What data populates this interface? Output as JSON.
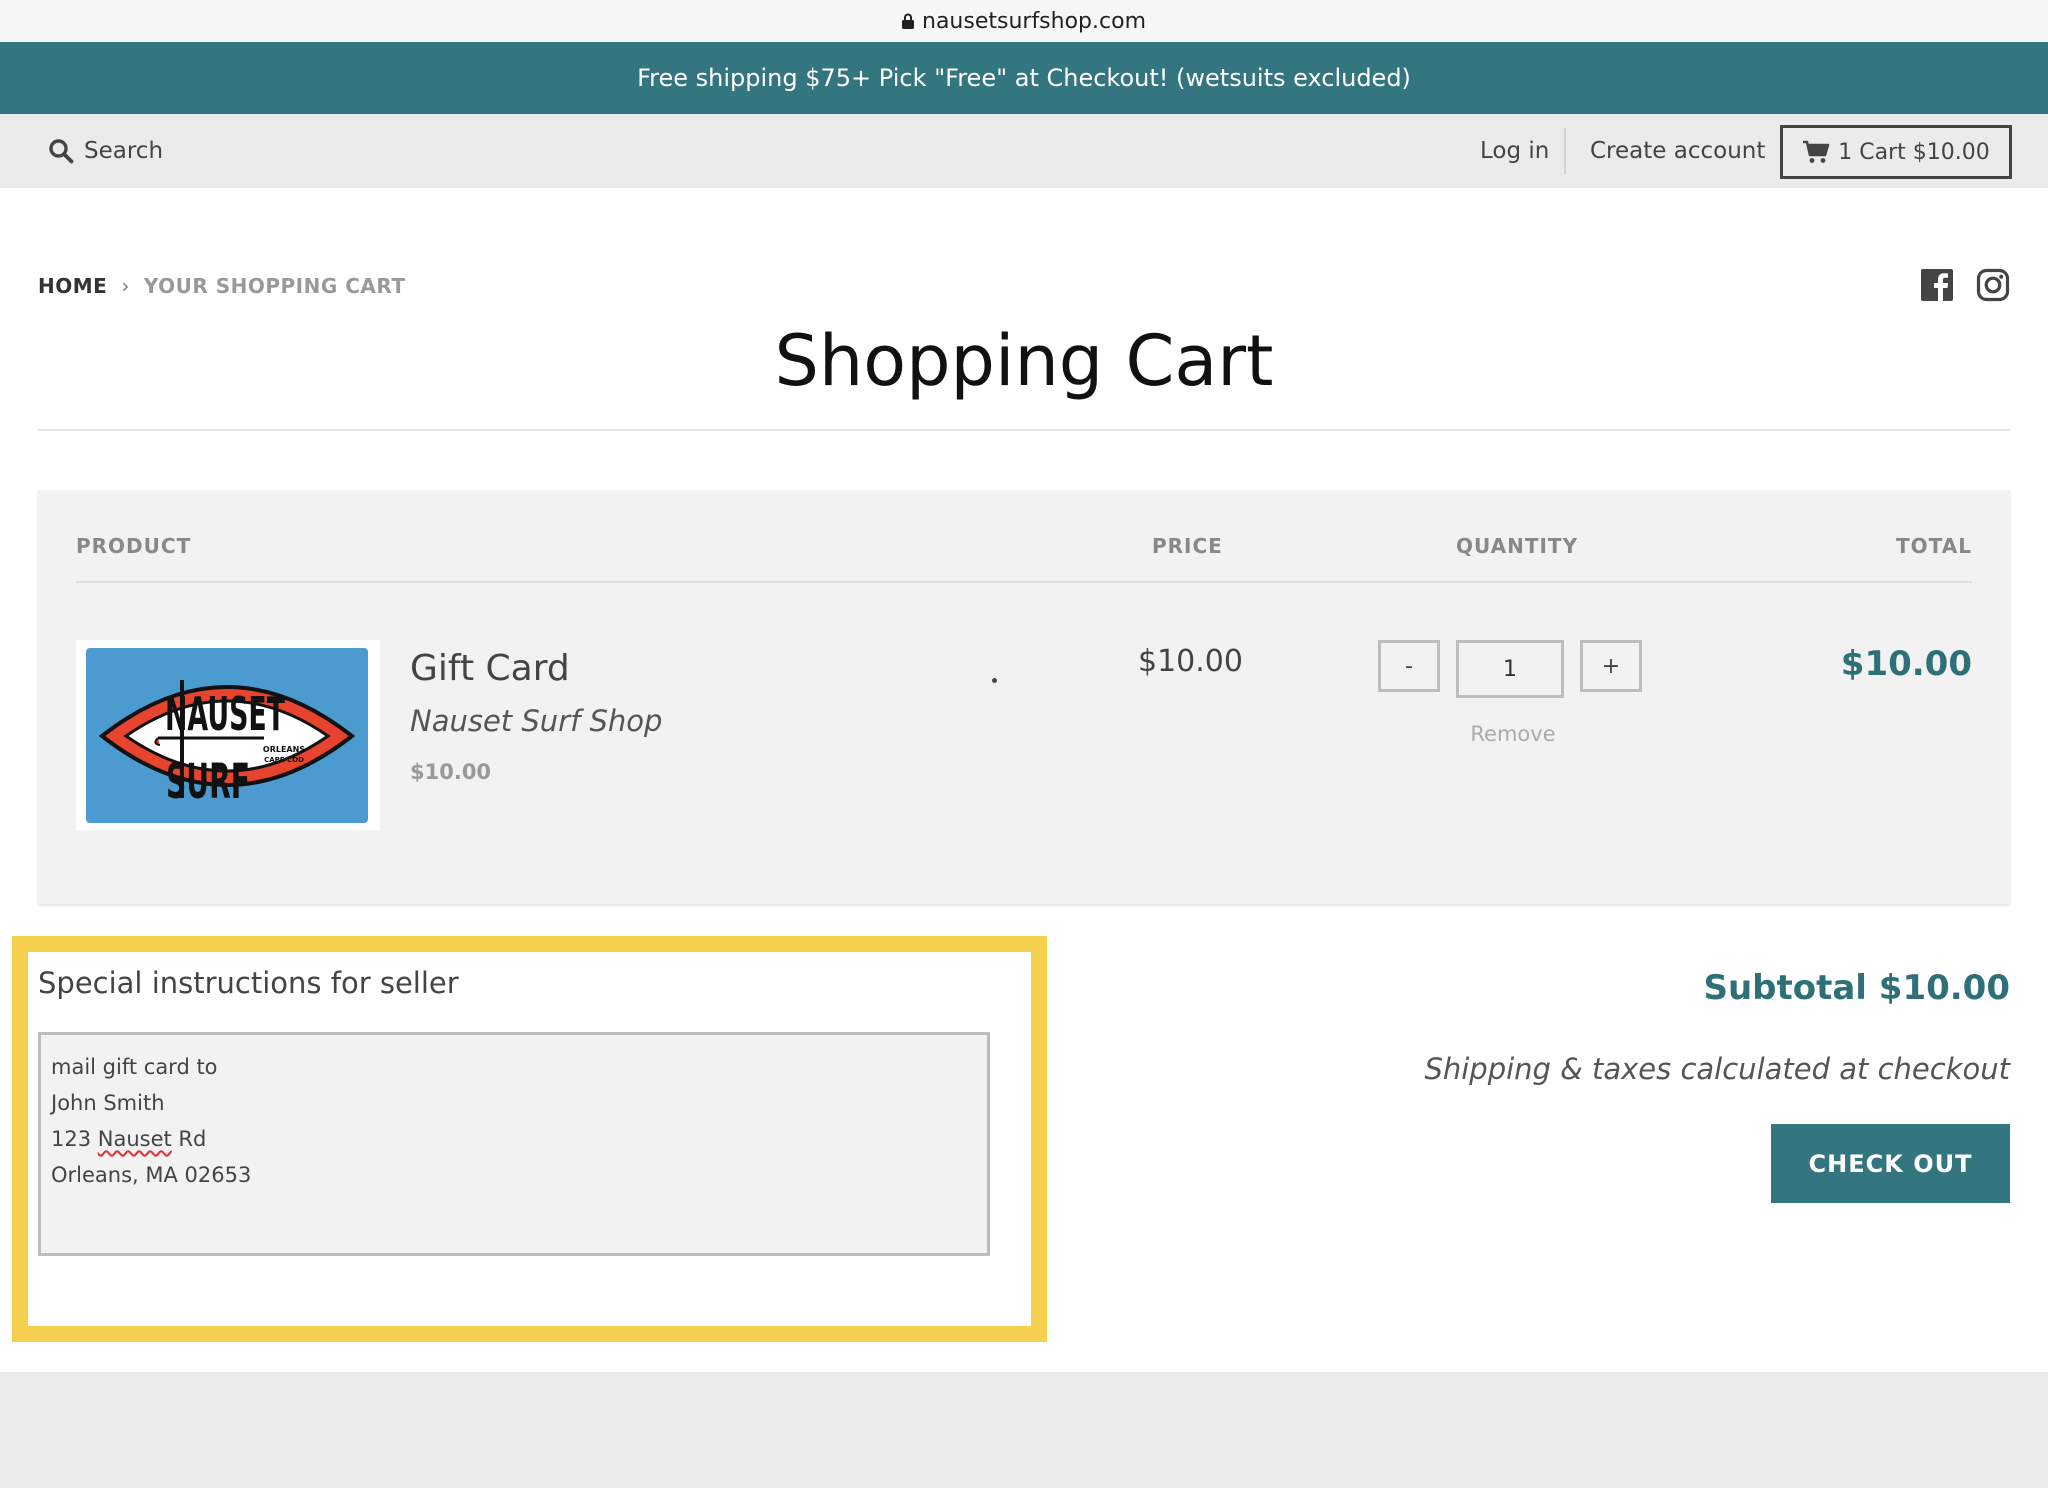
{
  "browser": {
    "url": "nausetsurfshop.com"
  },
  "announcement": "Free shipping $75+ Pick \"Free\" at Checkout! (wetsuits excluded)",
  "header": {
    "search_label": "Search",
    "login_label": "Log in",
    "create_account_label": "Create account",
    "cart_label": "1 Cart $10.00"
  },
  "breadcrumb": {
    "home": "HOME",
    "separator": "›",
    "current": "YOUR SHOPPING CART"
  },
  "page_title": "Shopping Cart",
  "cart": {
    "columns": {
      "product": "PRODUCT",
      "price": "PRICE",
      "quantity": "QUANTITY",
      "total": "TOTAL"
    },
    "items": [
      {
        "name": "Gift Card",
        "vendor": "Nauset Surf Shop",
        "unit_price": "$10.00",
        "price": "$10.00",
        "quantity": "1",
        "minus_label": "-",
        "plus_label": "+",
        "remove_label": "Remove",
        "line_total": "$10.00",
        "image": {
          "logo_text_top": "NAUSET",
          "logo_text_bottom": "SURF",
          "logo_small_1": "ORLEANS",
          "logo_small_2": "CAPE COD"
        }
      }
    ]
  },
  "instructions": {
    "label": "Special instructions for seller",
    "lines": [
      "mail gift card to",
      "John Smith",
      "123 ",
      "Nauset",
      " Rd",
      "Orleans, MA 02653"
    ]
  },
  "summary": {
    "subtotal": "Subtotal $10.00",
    "shipping_note": "Shipping & taxes calculated at checkout",
    "checkout_label": "CHECK OUT"
  },
  "colors": {
    "brand_teal": "#33767f",
    "highlight_yellow": "#f5d04f",
    "total_teal": "#2e6f78"
  }
}
